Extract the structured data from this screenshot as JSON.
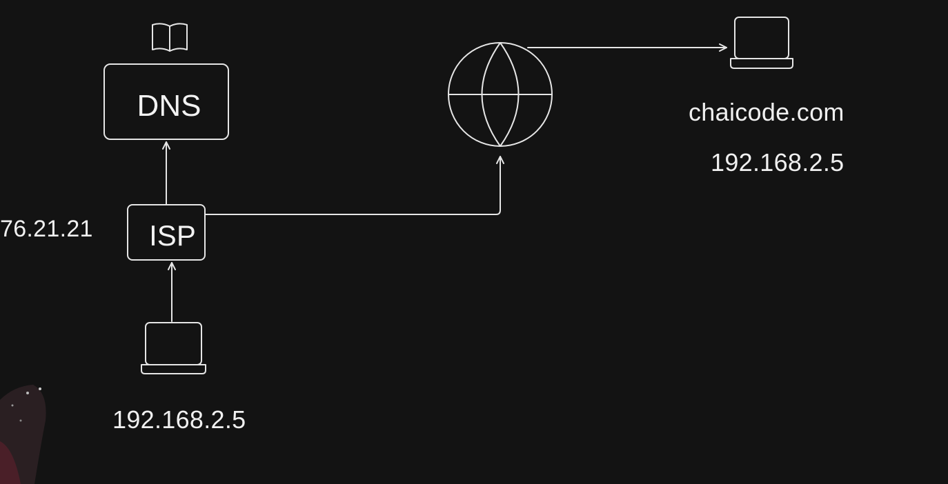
{
  "diagram": {
    "dns_label": "DNS",
    "isp_label": "ISP",
    "isp_ip": "76.21.21",
    "client_ip": "192.168.2.5",
    "server_domain": "chaicode.com",
    "server_ip": "192.168.2.5"
  },
  "colors": {
    "background": "#131313",
    "stroke": "#e6e6e6",
    "text": "#f0f0f0"
  },
  "icons": [
    "book-icon",
    "globe-icon",
    "laptop-icon"
  ]
}
